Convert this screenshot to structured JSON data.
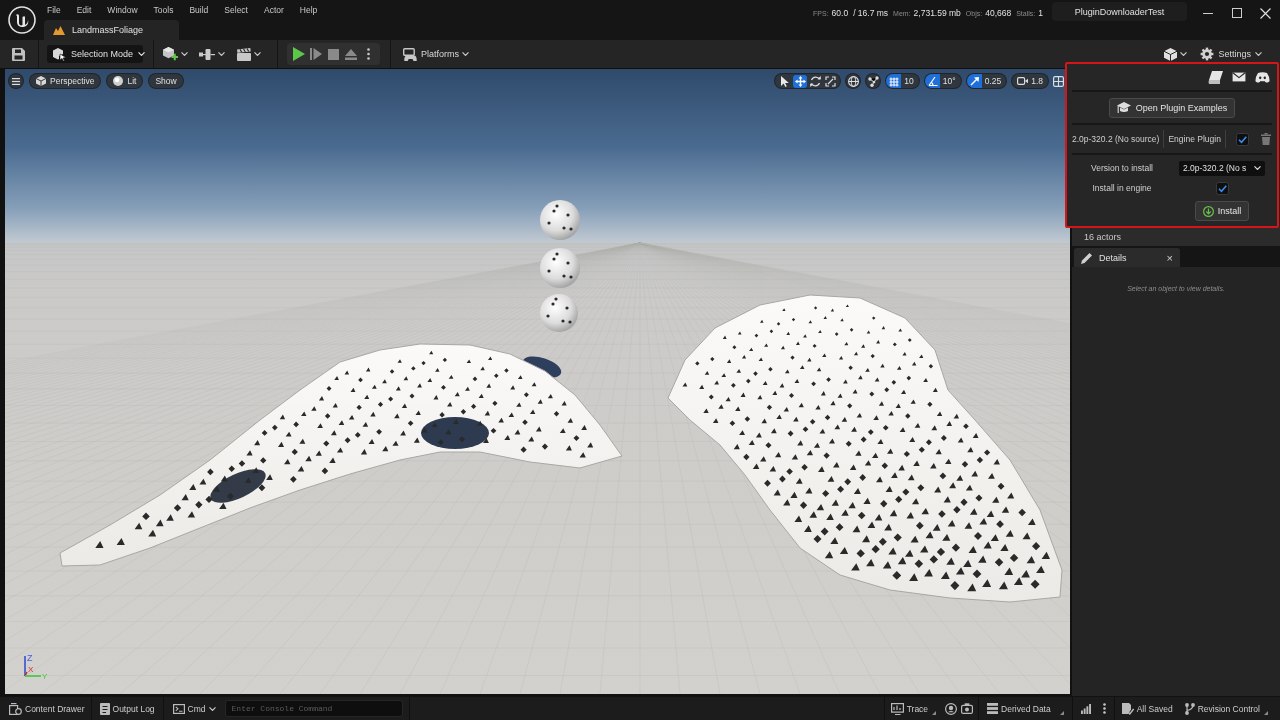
{
  "menu_bar": {
    "items": [
      "File",
      "Edit",
      "Window",
      "Tools",
      "Build",
      "Select",
      "Actor",
      "Help"
    ]
  },
  "document_tab": {
    "label": "LandmassFoliage"
  },
  "stats": [
    {
      "label": "FPS:",
      "value": "60.0"
    },
    {
      "value": "/ 16.7 ms"
    },
    {
      "label": "Mem:",
      "value": "2,731.59 mb"
    },
    {
      "label": "Objs:",
      "value": "40,668"
    },
    {
      "label": "Stalls:",
      "value": "1"
    }
  ],
  "project_name": "PluginDownloaderTest",
  "toolbar": {
    "mode_dropdown": "Selection Mode",
    "platforms": "Platforms",
    "settings": "Settings"
  },
  "viewport": {
    "view_buttons": [
      {
        "kind": "perspective",
        "label": "Perspective"
      },
      {
        "kind": "lit",
        "label": "Lit"
      },
      {
        "kind": "show",
        "label": "Show"
      }
    ],
    "transform_tools": [
      {
        "kind": "select",
        "selected": false
      },
      {
        "kind": "translate",
        "selected": true
      },
      {
        "kind": "rotate",
        "selected": false
      },
      {
        "kind": "scale",
        "selected": false
      }
    ],
    "snaps": [
      {
        "kind": "grid",
        "on": true,
        "value": "10"
      },
      {
        "kind": "rotation",
        "on": true,
        "value": "10°"
      },
      {
        "kind": "scale",
        "on": true,
        "value": "0.25"
      }
    ],
    "camera_speed": "1.8",
    "axis_labels": [
      "Z",
      "X",
      "Y"
    ]
  },
  "plugin_popup": {
    "open_examples_button": "Open Plugin Examples",
    "installed": {
      "version": "2.0p-320.2 (No source)",
      "type": "Engine Plugin",
      "checked": true
    },
    "version_label": "Version to install",
    "version_value": "2.0p-320.2 (No s",
    "install_in_engine": {
      "label": "Install in engine",
      "checked": true
    },
    "install_button": "Install"
  },
  "outliner": {
    "actor_count": "16 actors"
  },
  "details": {
    "tab": "Details",
    "close": "×",
    "empty_message": "Select an object to view details."
  },
  "status_bar": {
    "left": [
      {
        "kind": "content-drawer",
        "label": "Content Drawer"
      },
      {
        "kind": "output-log",
        "label": "Output Log"
      }
    ],
    "console": {
      "dropdown": "Cmd",
      "placeholder": "Enter Console Command"
    },
    "right": [
      {
        "kind": "trace",
        "label": "Trace"
      },
      {
        "kind": "insights"
      },
      {
        "kind": "screenshot"
      },
      {
        "kind": "derived-data",
        "label": "Derived Data"
      },
      {
        "kind": "bars"
      },
      {
        "kind": "more"
      },
      {
        "kind": "saved",
        "label": "All Saved"
      },
      {
        "kind": "revision-control",
        "label": "Revision Control"
      }
    ]
  }
}
